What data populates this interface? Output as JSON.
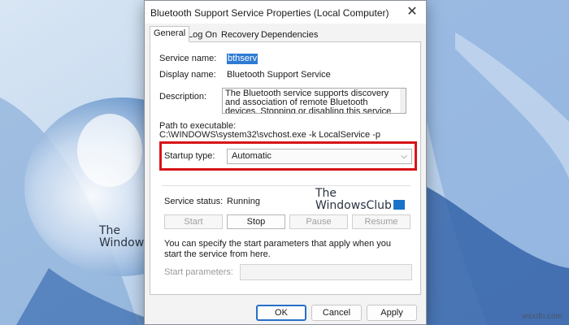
{
  "window": {
    "title": "Bluetooth Support Service Properties (Local Computer)",
    "close_glyph": "✕"
  },
  "tabs": [
    {
      "label": "General"
    },
    {
      "label": "Log On"
    },
    {
      "label": "Recovery"
    },
    {
      "label": "Dependencies"
    }
  ],
  "general": {
    "service_name_label": "Service name:",
    "service_name_value": "bthserv",
    "display_name_label": "Display name:",
    "display_name_value": "Bluetooth Support Service",
    "description_label": "Description:",
    "description_value": "The Bluetooth service supports discovery and association of remote Bluetooth devices.  Stopping or disabling this service may cause already installed",
    "path_label": "Path to executable:",
    "path_value": "C:\\WINDOWS\\system32\\svchost.exe -k LocalService -p",
    "startup_type_label": "Startup type:",
    "startup_type_value": "Automatic",
    "service_status_label": "Service status:",
    "service_status_value": "Running",
    "buttons": {
      "start": "Start",
      "stop": "Stop",
      "pause": "Pause",
      "resume": "Resume"
    },
    "help_text": "You can specify the start parameters that apply when you start the service from here.",
    "start_params_label": "Start parameters:",
    "start_params_value": ""
  },
  "dialog_buttons": {
    "ok": "OK",
    "cancel": "Cancel",
    "apply": "Apply"
  },
  "watermarks": [
    {
      "line1": "The",
      "line2": "WindowsClub"
    },
    {
      "line1": "The",
      "line2": "WindowsClub"
    }
  ],
  "credit": "wsxdn.com",
  "colors": {
    "highlight_border": "#d7141a",
    "selection": "#2f7bd4",
    "ok_border": "#2670c8"
  }
}
